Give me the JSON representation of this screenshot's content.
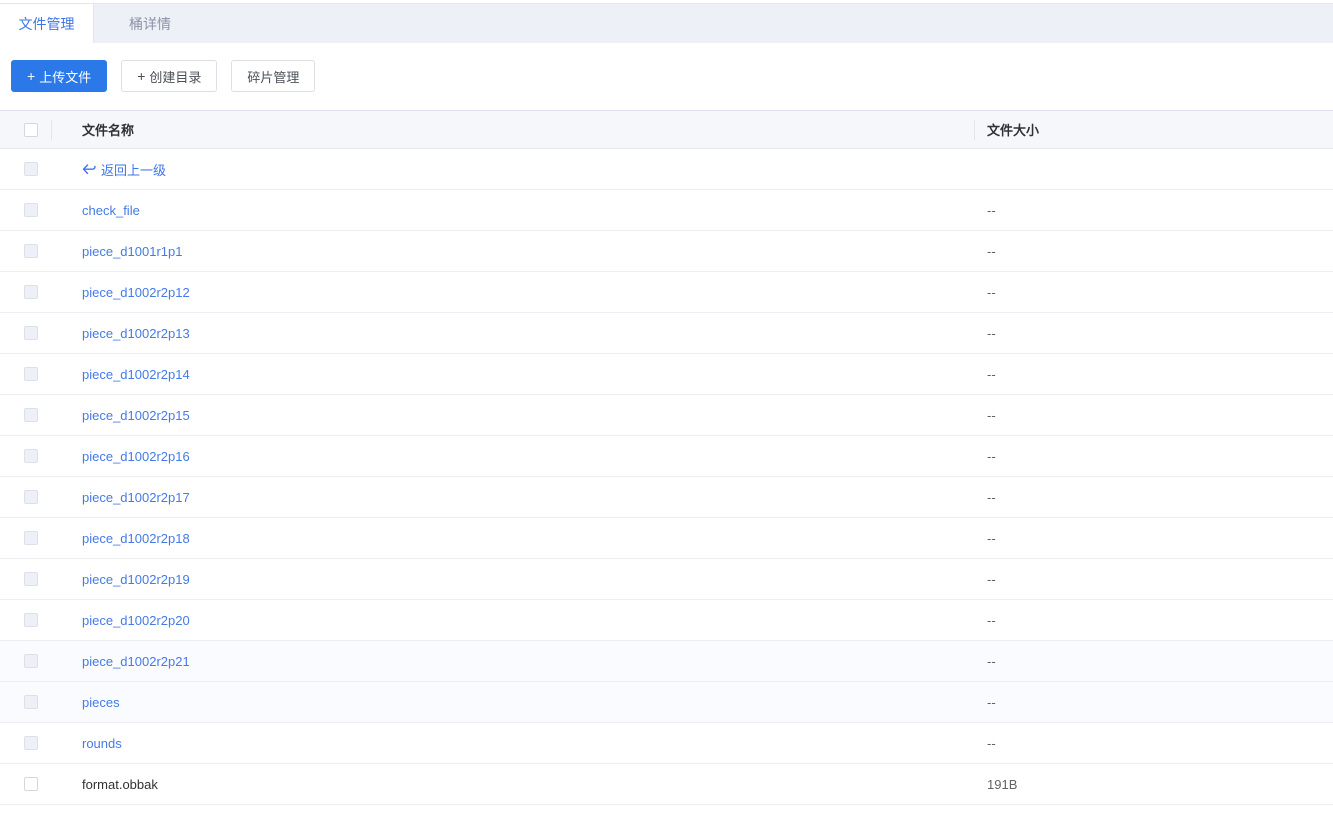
{
  "colors": {
    "accent": "#3d76e8",
    "primary_button_bg": "#2b79e8",
    "link": "#457ae8",
    "tabbar_bg": "#eef0f8",
    "header_bg": "#f6f7fa",
    "border": "#e3e6f0",
    "row_border": "#ebeef5",
    "tinted_row_bg": "#fafbfe"
  },
  "tabs": [
    {
      "label": "文件管理",
      "active": true
    },
    {
      "label": "桶详情",
      "active": false
    }
  ],
  "toolbar": {
    "plus_icon": "+",
    "buttons": [
      {
        "label": "上传文件",
        "has_plus": true,
        "primary": true
      },
      {
        "label": "创建目录",
        "has_plus": true,
        "primary": false
      },
      {
        "label": "碎片管理",
        "has_plus": false,
        "primary": false
      }
    ]
  },
  "file_table": {
    "columns": [
      {
        "label": "文件名称"
      },
      {
        "label": "文件大小"
      }
    ],
    "back_row": {
      "label": "返回上一级",
      "icon": "back-arrow-icon"
    },
    "rows": [
      {
        "name": "check_file",
        "size": "--",
        "type": "folder",
        "tinted": false
      },
      {
        "name": "piece_d1001r1p1",
        "size": "--",
        "type": "folder",
        "tinted": false
      },
      {
        "name": "piece_d1002r2p12",
        "size": "--",
        "type": "folder",
        "tinted": false
      },
      {
        "name": "piece_d1002r2p13",
        "size": "--",
        "type": "folder",
        "tinted": false
      },
      {
        "name": "piece_d1002r2p14",
        "size": "--",
        "type": "folder",
        "tinted": false
      },
      {
        "name": "piece_d1002r2p15",
        "size": "--",
        "type": "folder",
        "tinted": false
      },
      {
        "name": "piece_d1002r2p16",
        "size": "--",
        "type": "folder",
        "tinted": false
      },
      {
        "name": "piece_d1002r2p17",
        "size": "--",
        "type": "folder",
        "tinted": false
      },
      {
        "name": "piece_d1002r2p18",
        "size": "--",
        "type": "folder",
        "tinted": false
      },
      {
        "name": "piece_d1002r2p19",
        "size": "--",
        "type": "folder",
        "tinted": false
      },
      {
        "name": "piece_d1002r2p20",
        "size": "--",
        "type": "folder",
        "tinted": false
      },
      {
        "name": "piece_d1002r2p21",
        "size": "--",
        "type": "folder",
        "tinted": true
      },
      {
        "name": "pieces",
        "size": "--",
        "type": "folder",
        "tinted": true
      },
      {
        "name": "rounds",
        "size": "--",
        "type": "folder",
        "tinted": false
      },
      {
        "name": "format.obbak",
        "size": "191B",
        "type": "file",
        "tinted": false
      }
    ]
  }
}
